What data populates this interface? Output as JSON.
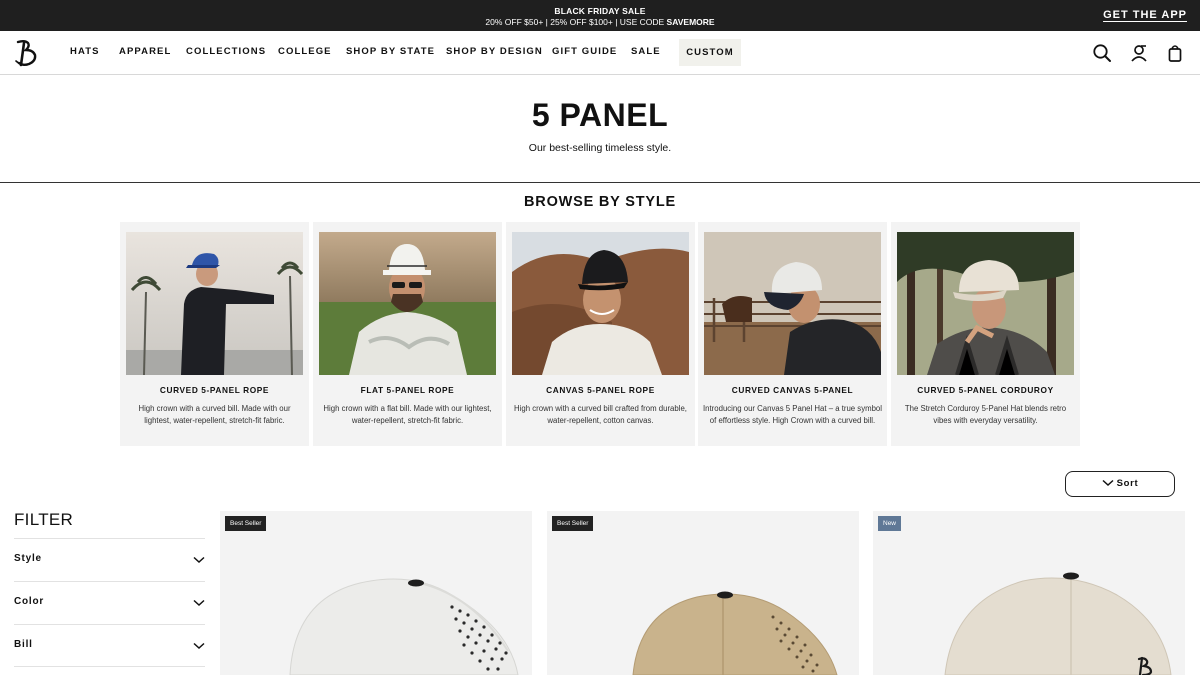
{
  "promo": {
    "title": "BLACK FRIDAY SALE",
    "offer": "20% OFF $50+ | 25% OFF $100+ | USE CODE",
    "code": "SAVEMORE",
    "app_link": "GET THE APP"
  },
  "nav": {
    "logo_icon": "brand-b-logo-icon",
    "items": [
      "HATS",
      "APPAREL",
      "COLLECTIONS",
      "COLLEGE",
      "SHOP BY STATE",
      "SHOP BY DESIGN",
      "GIFT GUIDE",
      "SALE"
    ],
    "custom": "CUSTOM",
    "icons": [
      "search-icon",
      "account-icon",
      "bag-icon"
    ]
  },
  "hero": {
    "title": "5 PANEL",
    "subtitle": "Our best-selling timeless style."
  },
  "browse": {
    "title": "BROWSE BY STYLE",
    "cards": [
      {
        "title": "CURVED 5-PANEL ROPE",
        "desc": "High crown with a curved bill. Made with our lightest, water-repellent, stretch-fit fabric."
      },
      {
        "title": "FLAT 5-PANEL ROPE",
        "desc": "High crown with a flat bill. Made with our lightest, water-repellent, stretch-fit fabric."
      },
      {
        "title": "CANVAS 5-PANEL ROPE",
        "desc": "High crown with a curved bill crafted from durable, water-repellent, cotton canvas."
      },
      {
        "title": "CURVED CANVAS 5-PANEL",
        "desc": "Introducing our Canvas 5 Panel Hat – a true symbol of effortless style. High Crown with a curved bill."
      },
      {
        "title": "CURVED 5-PANEL CORDUROY",
        "desc": "The Stretch Corduroy 5-Panel Hat blends retro vibes with everyday versatility."
      }
    ]
  },
  "sort": {
    "label": "Sort",
    "icon": "chevron-down-icon"
  },
  "filter": {
    "title": "FILTER",
    "groups": [
      "Style",
      "Color",
      "Bill"
    ]
  },
  "products": [
    {
      "badge": "Best Seller",
      "badge_color": "#222222",
      "hat_color": "#ececea"
    },
    {
      "badge": "Best Seller",
      "badge_color": "#222222",
      "hat_color": "#c9b38c"
    },
    {
      "badge": "New",
      "badge_color": "#5f7896",
      "hat_color": "#e4ddd0"
    }
  ]
}
